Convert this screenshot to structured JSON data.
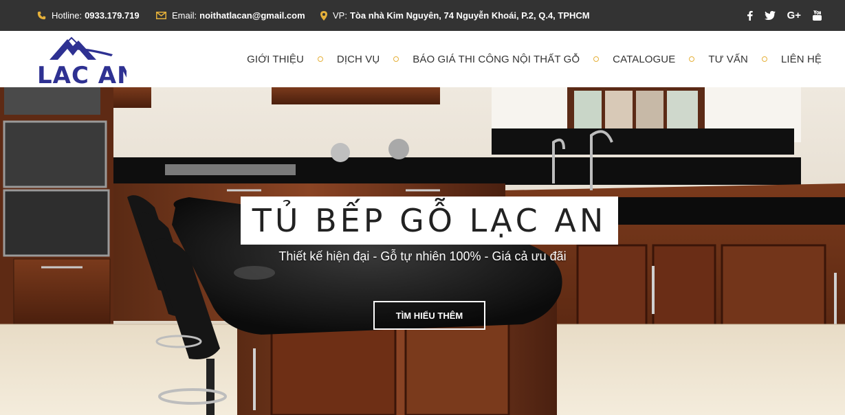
{
  "topbar": {
    "hotline_label": "Hotline:",
    "hotline_value": "0933.179.719",
    "email_label": "Email:",
    "email_value": "noithatlacan@gmail.com",
    "address_label": "VP:",
    "address_value": "Tòa nhà Kim Nguyên, 74 Nguyễn Khoái, P.2, Q.4, TPHCM",
    "icon_color": "#e5b03a",
    "social": [
      {
        "icon": "facebook-icon",
        "glyph": "f"
      },
      {
        "icon": "twitter-icon",
        "glyph": "t"
      },
      {
        "icon": "google-plus-icon",
        "glyph": "G+"
      },
      {
        "icon": "youtube-icon",
        "glyph": "yt"
      }
    ]
  },
  "header": {
    "logo_text": "LAC AN",
    "logo_color": "#2e3192",
    "nav": [
      {
        "label": "GIỚI THIỆU"
      },
      {
        "label": "DỊCH VỤ"
      },
      {
        "label": "BÁO GIÁ THI CÔNG NỘI THẤT GỖ"
      },
      {
        "label": "CATALOGUE"
      },
      {
        "label": "TƯ VẤN"
      },
      {
        "label": "LIÊN HỆ"
      }
    ]
  },
  "hero": {
    "title": "TỦ BẾP GỖ LẠC AN",
    "subtitle": "Thiết kế hiện đại - Gỗ tự nhiên 100% - Giá cả ưu đãi",
    "button_label": "TÌM HIỂU THÊM"
  }
}
